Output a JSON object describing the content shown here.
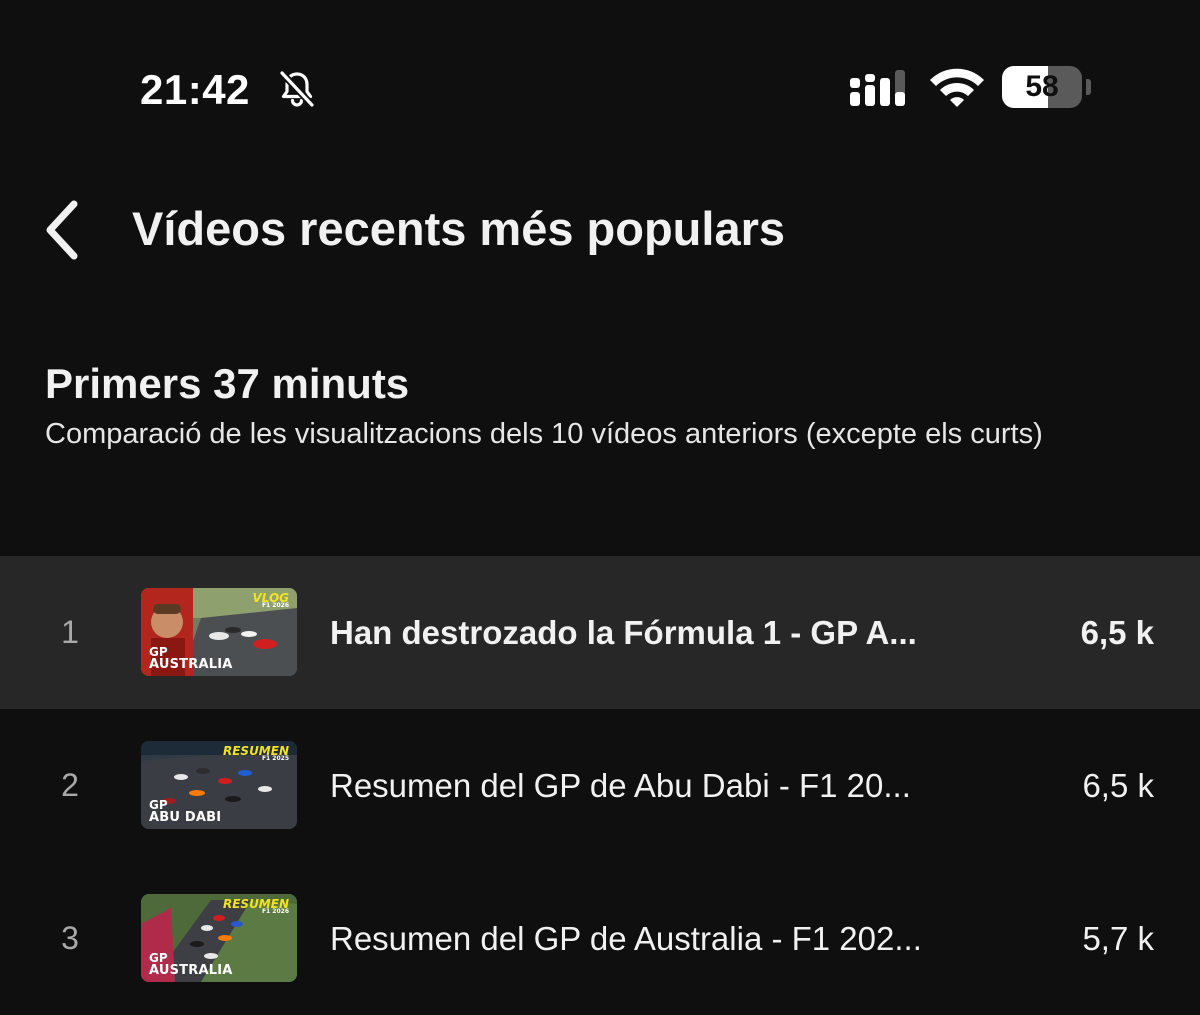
{
  "status_bar": {
    "time": "21:42",
    "battery_level": "58",
    "battery_fraction": 0.58,
    "icons": [
      "bell-slash-icon",
      "cellular-signal-icon",
      "wifi-icon",
      "battery-icon"
    ]
  },
  "header": {
    "back_icon": "chevron-left-icon",
    "title": "Vídeos recents més populars"
  },
  "section": {
    "title": "Primers 37 minuts",
    "subtitle": "Comparació de les visualitzacions dels 10 vídeos anteriors (excepte els curts)"
  },
  "videos": [
    {
      "rank": "1",
      "title": "Han destrozado la Fórmula 1 - GP A...",
      "views": "6,5 k",
      "thumb_tag": "VLOG",
      "thumb_tag_small": "F1 2026",
      "thumb_gp": "GP",
      "thumb_name": "AUSTRALIA"
    },
    {
      "rank": "2",
      "title": "Resumen del GP de Abu Dabi - F1 20...",
      "views": "6,5 k",
      "thumb_tag": "RESUMEN",
      "thumb_tag_small": "F1 2025",
      "thumb_gp": "GP",
      "thumb_name": "ABU DABI"
    },
    {
      "rank": "3",
      "title": "Resumen del GP de Australia - F1 202...",
      "views": "5,7 k",
      "thumb_tag": "RESUMEN",
      "thumb_tag_small": "F1 2026",
      "thumb_gp": "GP",
      "thumb_name": "AUSTRALIA"
    }
  ],
  "colors": {
    "background": "#0f0f0f",
    "highlight_row": "#272727",
    "text_primary": "#f1f1f1",
    "text_secondary": "#a9a9a9",
    "thumb_tag": "#f2e321"
  }
}
